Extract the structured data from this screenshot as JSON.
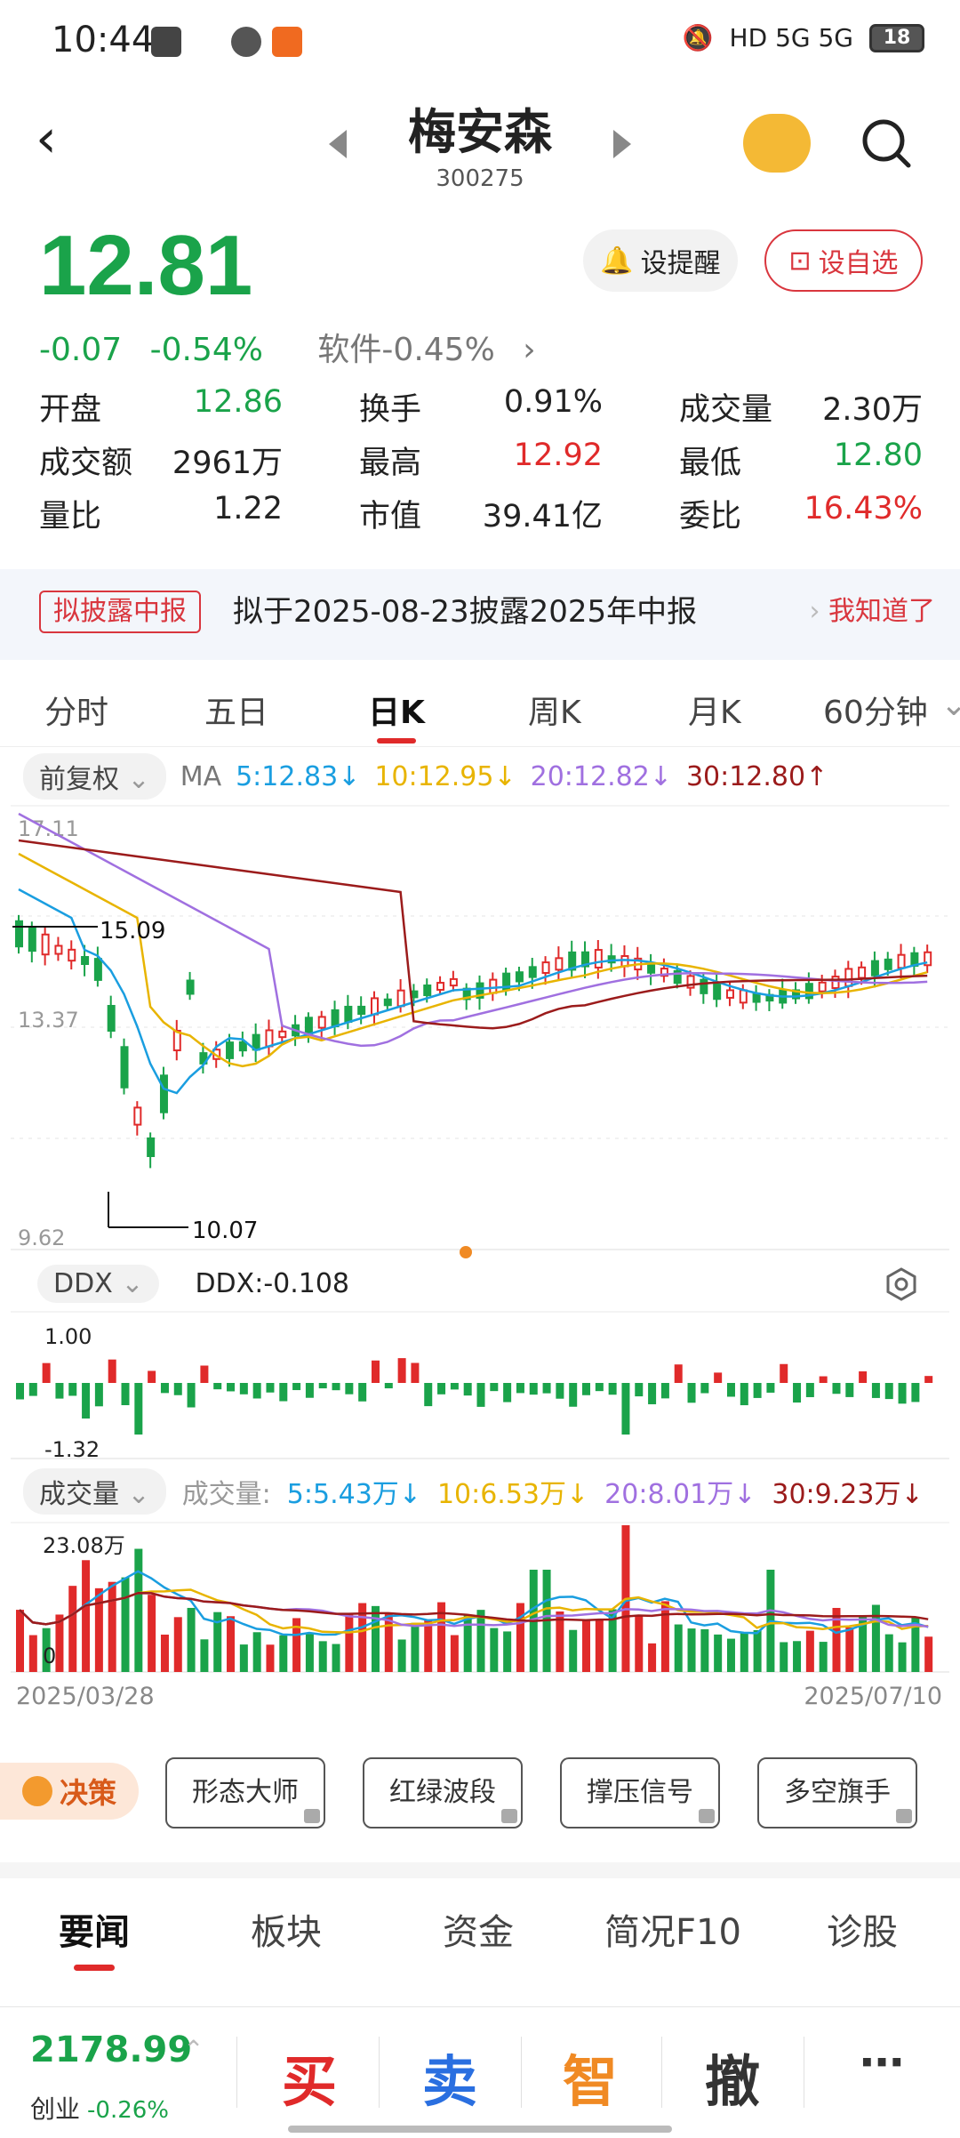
{
  "status_bar": {
    "time": "10:44",
    "network": "HD 5G 5G",
    "battery": "18"
  },
  "header": {
    "title": "梅安森",
    "code": "300275"
  },
  "quote": {
    "price": "12.81",
    "change": "-0.07",
    "change_pct": "-0.54%",
    "sector": "软件-0.45%",
    "remind_label": "设提醒",
    "fav_label": "设自选"
  },
  "stats": [
    {
      "label": "开盘",
      "value": "12.86",
      "color": "#1aa34a"
    },
    {
      "label": "换手",
      "value": "0.91%",
      "color": "#222222"
    },
    {
      "label": "成交量",
      "value": "2.30万",
      "color": "#222222"
    },
    {
      "label": "成交额",
      "value": "2961万",
      "color": "#222222"
    },
    {
      "label": "最高",
      "value": "12.92",
      "color": "#e02a2a"
    },
    {
      "label": "最低",
      "value": "12.80",
      "color": "#1aa34a"
    },
    {
      "label": "量比",
      "value": "1.22",
      "color": "#222222"
    },
    {
      "label": "市值",
      "value": "39.41亿",
      "color": "#222222"
    },
    {
      "label": "委比",
      "value": "16.43%",
      "color": "#e02a2a"
    }
  ],
  "notice": {
    "tag": "拟披露中报",
    "text": "拟于2025-08-23披露2025年中报",
    "link": "我知道了"
  },
  "kline_tabs": [
    "分时",
    "五日",
    "日K",
    "周K",
    "月K",
    "60分钟"
  ],
  "ma_bar": {
    "adjust": "前复权",
    "label": "MA",
    "ma5": "5:12.83↓",
    "ma10": "10:12.95↓",
    "ma20": "20:12.82↓",
    "ma30": "30:12.80↑"
  },
  "price_chart": {
    "top_label": "17.11",
    "mid_label": "13.37",
    "bottom_label": "9.62",
    "high_mark": "15.09",
    "low_mark": "10.07"
  },
  "ddx": {
    "selector": "DDX",
    "value": "DDX:-0.108",
    "top_label": "1.00",
    "bottom_label": "-1.32"
  },
  "volume": {
    "selector": "成交量",
    "label": "成交量:",
    "ma5": "5:5.43万↓",
    "ma10": "10:6.53万↓",
    "ma20": "20:8.01万↓",
    "ma30": "30:9.23万↓",
    "top_label": "23.08万",
    "bottom_label": "0"
  },
  "dates": {
    "start": "2025/03/28",
    "end": "2025/07/10"
  },
  "tools": {
    "decide": "决策",
    "buttons": [
      "形态大师",
      "红绿波段",
      "撑压信号",
      "多空旗手"
    ]
  },
  "news_tabs": [
    "要闻",
    "板块",
    "资金",
    "简况F10",
    "诊股"
  ],
  "bottom_bar": {
    "index_value": "2178.99",
    "index_name": "创业",
    "index_change": "-0.26%",
    "buy": "买",
    "sell": "卖",
    "smart": "智",
    "cancel": "撤",
    "more": "⋯"
  },
  "colors": {
    "up": "#e02a2a",
    "down": "#1aa34a",
    "ma5": "#1a9ee0",
    "ma10": "#e8b400",
    "ma20": "#a070e0",
    "ma30": "#9b1b1b"
  }
}
